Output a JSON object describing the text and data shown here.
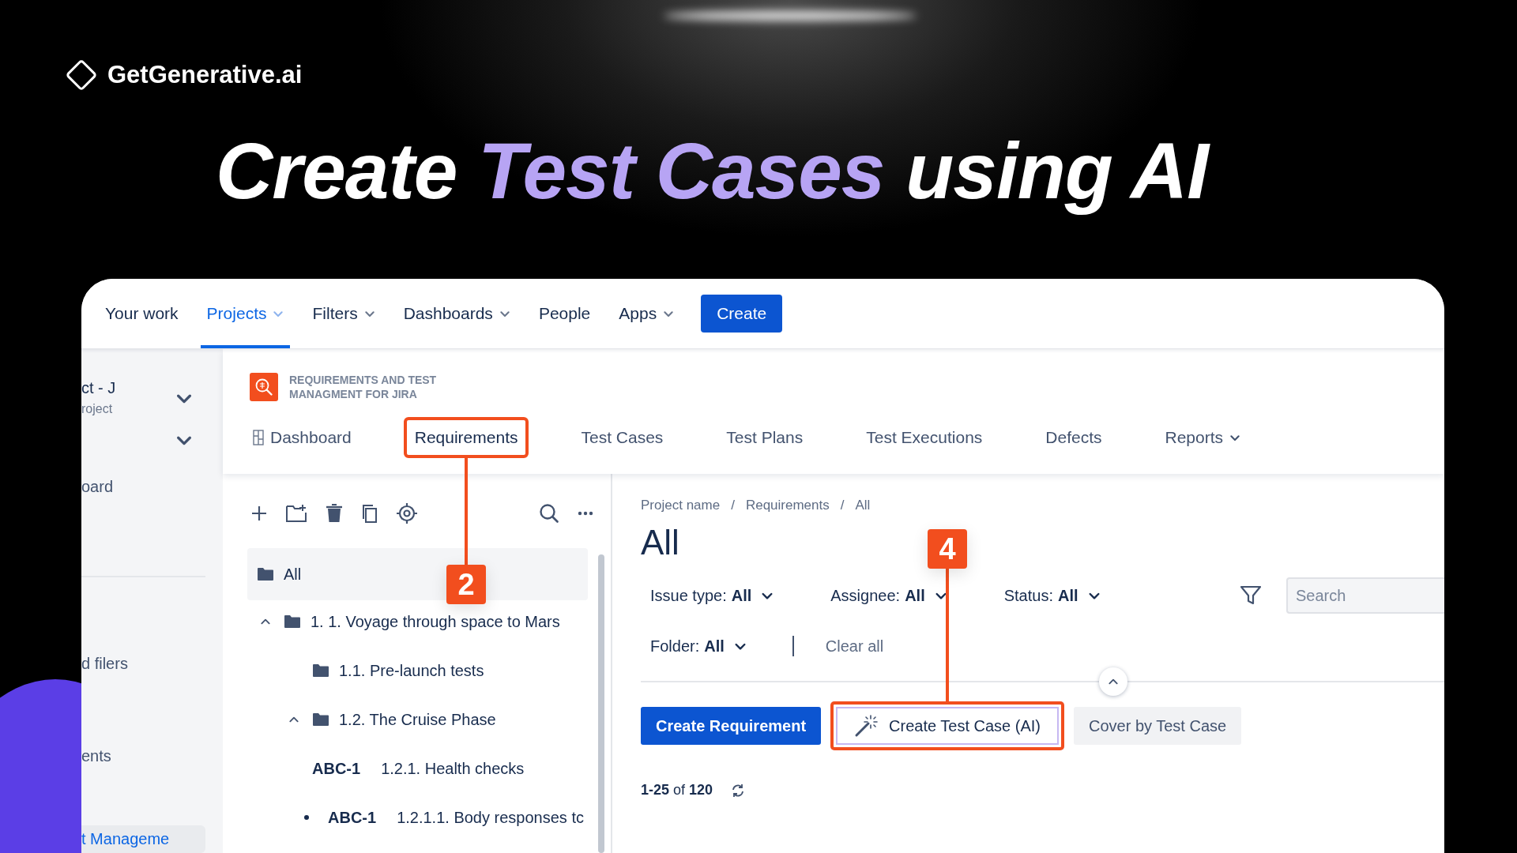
{
  "brand": {
    "name": "GetGenerative.ai"
  },
  "headline": [
    {
      "text": "Create ",
      "accent": false
    },
    {
      "text": "Test Cases",
      "accent": true
    },
    {
      "text": " using AI",
      "accent": false
    }
  ],
  "topnav": {
    "items": [
      {
        "label": "Your work",
        "selected": false,
        "menu": false
      },
      {
        "label": "Projects",
        "selected": true,
        "menu": true
      },
      {
        "label": "Filters",
        "selected": false,
        "menu": true
      },
      {
        "label": "Dashboards",
        "selected": false,
        "menu": true
      },
      {
        "label": "People",
        "selected": false,
        "menu": false
      },
      {
        "label": "Apps",
        "selected": false,
        "menu": true
      }
    ],
    "create_button": "Create"
  },
  "sidebar": {
    "items": [
      {
        "kind": "project",
        "title": "ct - J",
        "subtitle": "roject"
      },
      {
        "kind": "toggle"
      },
      {
        "kind": "link",
        "label": "oard",
        "selected": false
      },
      {
        "kind": "divider"
      },
      {
        "kind": "link",
        "label": "d filers",
        "selected": false
      },
      {
        "kind": "link",
        "label": "ents",
        "selected": false
      },
      {
        "kind": "link",
        "label": "t Manageme",
        "selected": true
      }
    ]
  },
  "app": {
    "name": "REQUIREMENTS AND TEST MANAGMENT FOR JIRA",
    "tabs": [
      {
        "label": "Dashboard",
        "kind": "icon",
        "highlighted": false
      },
      {
        "label": "Requirements",
        "kind": "plain",
        "highlighted": true,
        "callout": "2"
      },
      {
        "label": "Test Cases",
        "kind": "plain",
        "highlighted": false
      },
      {
        "label": "Test Plans",
        "kind": "plain",
        "highlighted": false
      },
      {
        "label": "Test Executions",
        "kind": "plain",
        "highlighted": false
      },
      {
        "label": "Defects",
        "kind": "plain",
        "highlighted": false
      },
      {
        "label": "Reports",
        "kind": "menu",
        "highlighted": false
      }
    ]
  },
  "tree": {
    "items": [
      {
        "kind": "folder",
        "label": "All",
        "selected": true,
        "children": [
          {
            "kind": "folder",
            "label": "1. 1. Voyage through space to Mars",
            "selected": false,
            "expanded": true,
            "children": [
              {
                "kind": "folder",
                "label": "1.1. Pre-launch tests",
                "selected": false
              },
              {
                "kind": "folder",
                "label": "1.2. The Cruise Phase",
                "selected": false,
                "expanded": true,
                "children": [
                  {
                    "kind": "issue",
                    "key": "ABC-1",
                    "label": "1.2.1. Health checks",
                    "selected": false,
                    "children": [
                      {
                        "kind": "sub-issue",
                        "key": "ABC-1",
                        "label": "1.2.1.1. Body responses tc",
                        "selected": false
                      }
                    ]
                  }
                ]
              }
            ]
          }
        ]
      }
    ]
  },
  "content": {
    "breadcrumb": [
      "Project name",
      "Requirements",
      "All"
    ],
    "breadcrumb_separator": "/",
    "title": "All",
    "filters": [
      {
        "label": "Issue type:",
        "value": "All"
      },
      {
        "label": "Assignee:",
        "value": "All"
      },
      {
        "label": "Status:",
        "value": "All"
      }
    ],
    "search": {
      "placeholder": "Search"
    },
    "folder_filter": {
      "label": "Folder:",
      "value": "All"
    },
    "clear_all": "Clear all",
    "actions": [
      {
        "label": "Create Requirement",
        "kind": "primary",
        "highlighted": false
      },
      {
        "label": "Create Test Case (AI)",
        "kind": "ai",
        "highlighted": true,
        "callout": "4"
      },
      {
        "label": "Cover by Test Case",
        "kind": "secondary",
        "highlighted": false
      }
    ],
    "pager": "**1-25** of **120**"
  }
}
